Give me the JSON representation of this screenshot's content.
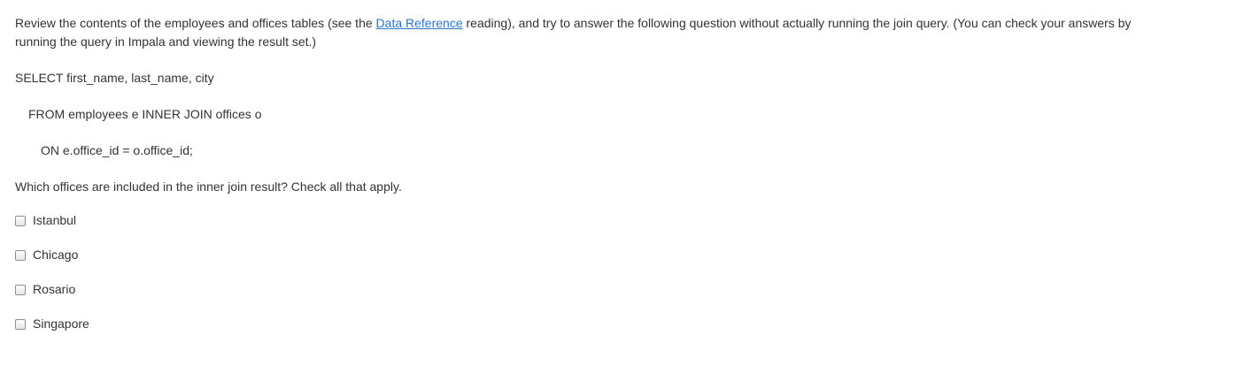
{
  "question": {
    "intro_before_link": "Review the contents of the employees and offices tables (see the ",
    "intro_link": "Data Reference",
    "intro_after_link_line1": " reading), and try to answer the following question without actually running the join query. (You can check your answers by",
    "intro_line2": "running the query in Impala and viewing the result set.)",
    "sql": {
      "line1": "SELECT first_name, last_name, city",
      "line2": "FROM employees e INNER JOIN offices o",
      "line3": "ON e.office_id = o.office_id;"
    },
    "prompt": "Which offices are included in the inner join result? Check all that apply.",
    "options": [
      {
        "label": "Istanbul"
      },
      {
        "label": "Chicago"
      },
      {
        "label": "Rosario"
      },
      {
        "label": "Singapore"
      }
    ]
  }
}
